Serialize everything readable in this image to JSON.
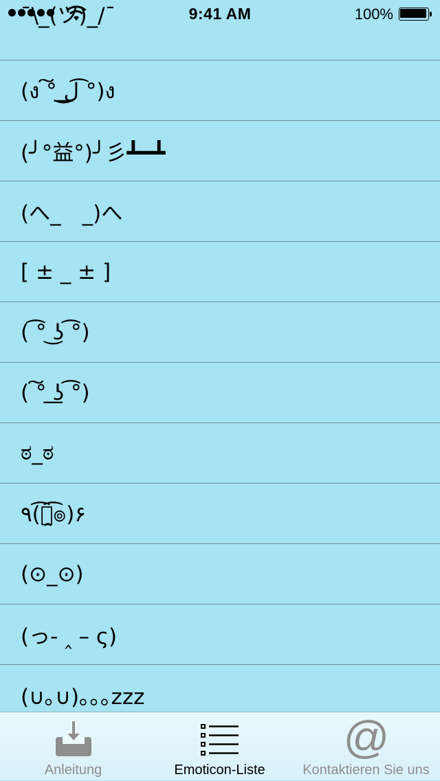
{
  "status_bar": {
    "time": "9:41 AM",
    "battery": "100%"
  },
  "emoticons": [
    {
      "text": "¯\\_(ツ)_/¯"
    },
    {
      "text": "(ง ͠° ͟ل͜ ͡°)ง"
    },
    {
      "text": "(╯°益°)╯彡┻━┻"
    },
    {
      "text": "(へ_　_)へ"
    },
    {
      "text": "[ ± _ ± ]"
    },
    {
      "text": "( ͡° ͜ʖ ͡°)"
    },
    {
      "text": "( ͠° ͟ʖ ͡°)"
    },
    {
      "text": "ಠ_ಠ"
    },
    {
      "text": "٩(͡๏̯͡๏)۶"
    },
    {
      "text": "(⊙_⊙)"
    },
    {
      "text": "(っ- ‸ – ς)"
    },
    {
      "text": "(∪｡∪)｡｡｡zzz"
    }
  ],
  "tabbar": {
    "tabs": [
      {
        "label": "Anleitung",
        "icon": "download-tray-icon",
        "active": false
      },
      {
        "label": "Emoticon-Liste",
        "icon": "list-icon",
        "active": true
      },
      {
        "label": "Kontaktieren Sie uns",
        "icon": "at-sign-icon",
        "active": false
      }
    ]
  },
  "colors": {
    "background": "#a6e3f3",
    "separator": "#6f8d95",
    "tab_inactive": "#8e8e8e",
    "tab_active": "#000000"
  }
}
